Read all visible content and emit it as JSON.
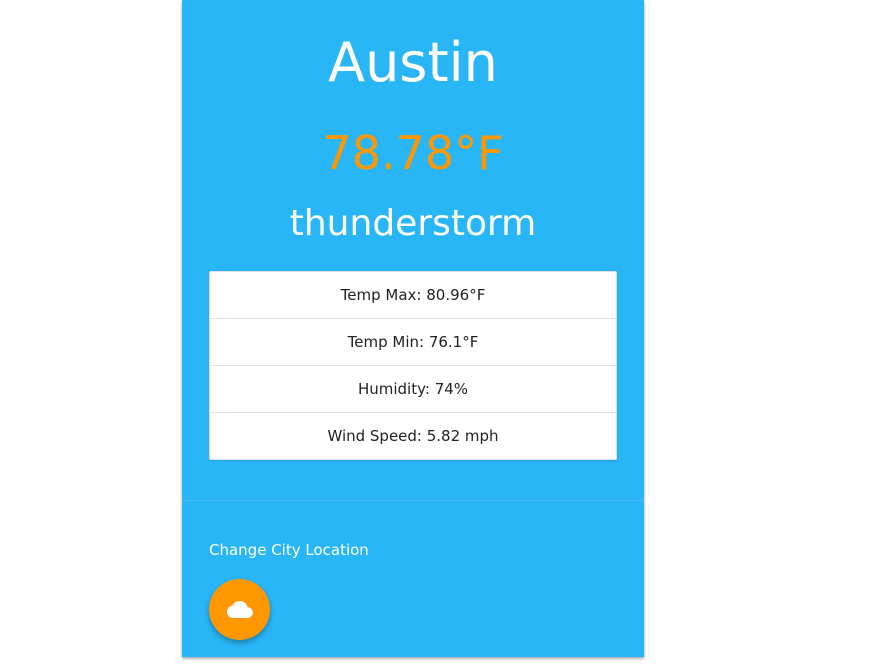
{
  "weather": {
    "city": "Austin",
    "temperature": "78.78°F",
    "condition": "thunderstorm"
  },
  "details": [
    {
      "text": "Temp Max: 80.96°F"
    },
    {
      "text": "Temp Min: 76.1°F"
    },
    {
      "text": "Humidity: 74%"
    },
    {
      "text": "Wind Speed: 5.82 mph"
    }
  ],
  "actions": {
    "change_city_label": "Change City Location",
    "fab_icon": "cloud-icon"
  },
  "colors": {
    "card_background": "#29b6f6",
    "accent": "#ff9800",
    "text_light": "#ffffff"
  }
}
